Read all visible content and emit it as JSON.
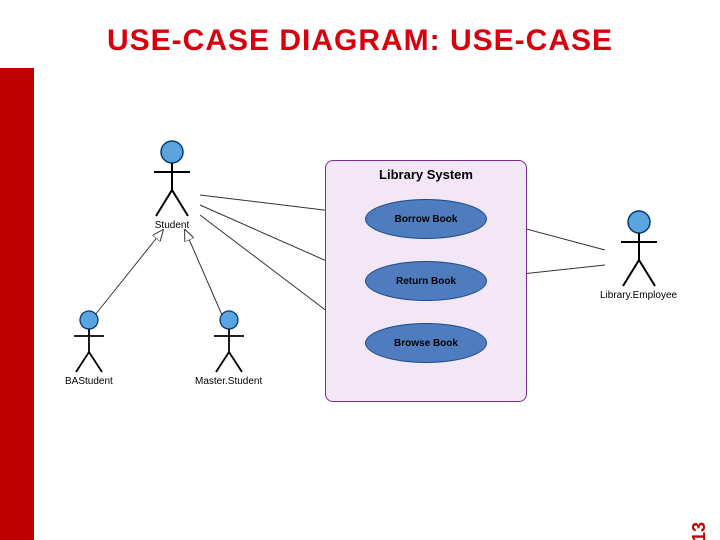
{
  "title": "USE-CASE DIAGRAM: USE-CASE",
  "page_number": "13",
  "system": {
    "title": "Library System"
  },
  "usecases": {
    "uc1": "Borrow Book",
    "uc2": "Return Book",
    "uc3": "Browse Book"
  },
  "actors": {
    "student": "Student",
    "ba": "BAStudent",
    "master": "Master.Student",
    "librarian": "Library.Employee"
  },
  "chart_data": {
    "type": "diagram",
    "notation": "UML use-case diagram",
    "system_boundary": "Library System",
    "actors": [
      {
        "id": "Student",
        "role": "primary"
      },
      {
        "id": "BAStudent",
        "role": "primary",
        "generalizes_to": "Student"
      },
      {
        "id": "Master.Student",
        "role": "primary",
        "generalizes_to": "Student"
      },
      {
        "id": "Library.Employee",
        "role": "secondary"
      }
    ],
    "use_cases": [
      "Borrow Book",
      "Return Book",
      "Browse Book"
    ],
    "associations": [
      {
        "actor": "Student",
        "use_case": "Borrow Book"
      },
      {
        "actor": "Student",
        "use_case": "Return Book"
      },
      {
        "actor": "Student",
        "use_case": "Browse Book"
      },
      {
        "actor": "Library.Employee",
        "use_case": "Borrow Book"
      },
      {
        "actor": "Library.Employee",
        "use_case": "Return Book"
      }
    ],
    "generalizations": [
      {
        "child": "BAStudent",
        "parent": "Student"
      },
      {
        "child": "Master.Student",
        "parent": "Student"
      }
    ]
  }
}
